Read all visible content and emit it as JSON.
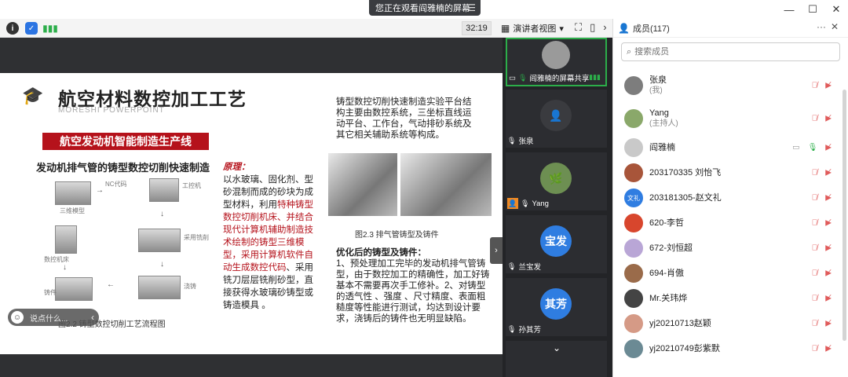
{
  "titlebar": {
    "share_notice": "您正在观看阎雅楠的屏幕",
    "pill_icon": "list-icon"
  },
  "toolbar": {
    "timer": "32:19",
    "view_mode": "演讲者视图"
  },
  "slide": {
    "title": "航空材料数控加工工艺",
    "subtitle": "MORESHI POWERPOINT",
    "banner": "航空发动机智能制造生产线",
    "flow_title": "发动机排气管的铸型数控切削快速制造",
    "flow_labels": [
      "NC代码",
      "三维模型",
      "工控机",
      "数控机床",
      "铸件",
      "浇铸",
      "采用铣削"
    ],
    "flow_caption": "图2.2  铸型数控切削工艺流程图",
    "principle": {
      "header": "原理：",
      "text_1": "以水玻璃、固化剂、型砂混制而成的砂块为成型材料，利用",
      "text_red": "特种铸型数控切削机床、并结合现代计算机辅助制造技术绘制的铸型三维模型，采用计算机软件自动生成数控代码",
      "text_2": "、采用铣刀层层铣削砂型，直接获得水玻璃砂铸型或铸造模具 。"
    },
    "right_text": "铸型数控切削快速制造实验平台结构主要由数控系统，三坐标直线运动平台、工作台，气动排砂系统及其它相关辅助系统等构成。",
    "photo_caption": "图2.3  排气管铸型及铸件",
    "optimized": {
      "header": "优化后的铸型及铸件：",
      "text": "1、预处理加工完毕的发动机排气管铸型，由于数控加工的精确性，加工好铸基本不需要再次手工修补。2、对铸型的透气性 、强度 、尺寸精度、表面粗糙度等性能进行测试，均达到设计要求，浇铸后的铸件也无明显缺陷。"
    },
    "say_something": "说点什么..."
  },
  "videos": [
    {
      "name": "阎雅楠的屏幕共享",
      "mic": "on",
      "active": true
    },
    {
      "name": "张泉",
      "mic": "off"
    },
    {
      "name": "Yang",
      "mic": "off",
      "host": true
    },
    {
      "name": "兰宝发",
      "mic": "off",
      "avatar_text": "宝发",
      "avatar_color": "#2f7de1"
    },
    {
      "name": "孙其芳",
      "mic": "off",
      "avatar_text": "其芳",
      "avatar_color": "#2f7de1"
    }
  ],
  "members": {
    "title": "成员(117)",
    "search_placeholder": "搜索成员",
    "list": [
      {
        "name": "张泉",
        "role": "(我)",
        "color": "#7d7d7d"
      },
      {
        "name": "Yang",
        "role": "(主持人)",
        "color": "#8aa86a"
      },
      {
        "name": "阎雅楠",
        "role": "",
        "color": "#c9c9c9",
        "sharing": true
      },
      {
        "name": "203170335 刘怡飞",
        "role": "",
        "color": "#a8553a"
      },
      {
        "name": "203181305-赵文礼",
        "role": "",
        "color": "#2f7de1",
        "avatar_text": "文礼"
      },
      {
        "name": "620-李哲",
        "role": "",
        "color": "#d8462d"
      },
      {
        "name": "672-刘恒超",
        "role": "",
        "color": "#b9a6d6"
      },
      {
        "name": "694-肖傲",
        "role": "",
        "color": "#9a6b4a"
      },
      {
        "name": "Mr.关玮烨",
        "role": "",
        "color": "#444444"
      },
      {
        "name": "yj20210713赵颖",
        "role": "",
        "color": "#d59a86"
      },
      {
        "name": "yj20210749彭紫默",
        "role": "",
        "color": "#6b8a94"
      }
    ]
  },
  "colors": {
    "accent_red": "#b5121b",
    "mic_on": "#2cae4a",
    "muted": "#e05b5b",
    "blue_avatar": "#2f7de1"
  }
}
